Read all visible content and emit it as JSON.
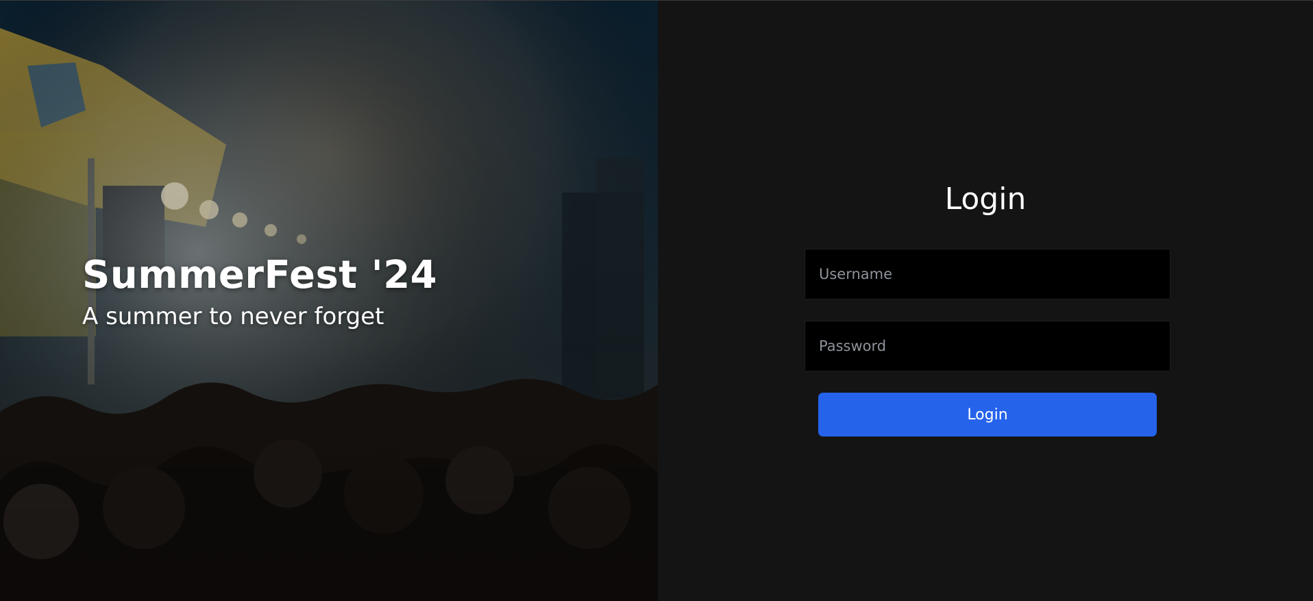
{
  "hero": {
    "title": "SummerFest '24",
    "subtitle": "A summer to never forget",
    "image": "concert-crowd-confetti-photo"
  },
  "login": {
    "title": "Login",
    "username_placeholder": "Username",
    "password_placeholder": "Password",
    "username_value": "",
    "password_value": "",
    "button_label": "Login"
  },
  "colors": {
    "panel_bg": "#141414",
    "input_bg": "#000000",
    "button_bg": "#2563eb",
    "text": "#ffffff",
    "placeholder": "#8e939b"
  }
}
